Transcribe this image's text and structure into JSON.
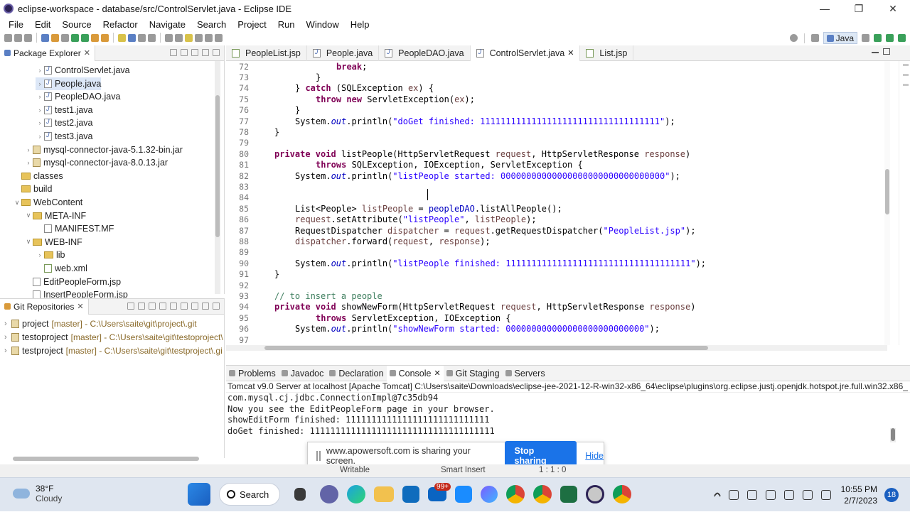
{
  "window": {
    "title": "eclipse-workspace - database/src/ControlServlet.java - Eclipse IDE"
  },
  "menu": [
    "File",
    "Edit",
    "Source",
    "Refactor",
    "Navigate",
    "Search",
    "Project",
    "Run",
    "Window",
    "Help"
  ],
  "perspective": "Java",
  "package_explorer": {
    "title": "Package Explorer",
    "items": [
      {
        "label": "ControlServlet.java",
        "icon": "java",
        "indent": 1,
        "twisty": true
      },
      {
        "label": "People.java",
        "icon": "java",
        "indent": 1,
        "twisty": true,
        "selected": true
      },
      {
        "label": "PeopleDAO.java",
        "icon": "java",
        "indent": 1,
        "twisty": true
      },
      {
        "label": "test1.java",
        "icon": "java",
        "indent": 1,
        "twisty": true
      },
      {
        "label": "test2.java",
        "icon": "java",
        "indent": 1,
        "twisty": true
      },
      {
        "label": "test3.java",
        "icon": "java",
        "indent": 1,
        "twisty": true
      },
      {
        "label": "mysql-connector-java-5.1.32-bin.jar",
        "icon": "jar",
        "indent": 0,
        "twisty": true
      },
      {
        "label": "mysql-connector-java-8.0.13.jar",
        "icon": "jar",
        "indent": 0,
        "twisty": true
      },
      {
        "label": "classes",
        "icon": "folder",
        "indent": -1,
        "twisty": false
      },
      {
        "label": "build",
        "icon": "folder",
        "indent": -1,
        "twisty": false
      },
      {
        "label": "WebContent",
        "icon": "folder",
        "indent": -1,
        "twisty": "open"
      },
      {
        "label": "META-INF",
        "icon": "folder",
        "indent": 0,
        "twisty": "open"
      },
      {
        "label": "MANIFEST.MF",
        "icon": "file",
        "indent": 1,
        "twisty": false
      },
      {
        "label": "WEB-INF",
        "icon": "folder",
        "indent": 0,
        "twisty": "open"
      },
      {
        "label": "lib",
        "icon": "folder",
        "indent": 1,
        "twisty": true
      },
      {
        "label": "web.xml",
        "icon": "xml",
        "indent": 1,
        "twisty": false
      },
      {
        "label": "EditPeopleForm.jsp",
        "icon": "file",
        "indent": 0,
        "twisty": false
      },
      {
        "label": "InsertPeopleForm.jsp",
        "icon": "file",
        "indent": 0,
        "twisty": false
      }
    ]
  },
  "git_repositories": {
    "title": "Git Repositories",
    "items": [
      {
        "name": "project",
        "meta": "[master] - C:\\Users\\saite\\git\\project\\.git"
      },
      {
        "name": "testoproject",
        "meta": "[master] - C:\\Users\\saite\\git\\testoproject\\"
      },
      {
        "name": "testproject",
        "meta": "[master] - C:\\Users\\saite\\git\\testproject\\.gi"
      }
    ]
  },
  "editor": {
    "tabs": [
      {
        "label": "PeopleList.jsp",
        "active": false
      },
      {
        "label": "People.java",
        "active": false
      },
      {
        "label": "PeopleDAO.java",
        "active": false
      },
      {
        "label": "ControlServlet.java",
        "active": true
      },
      {
        "label": "List.jsp",
        "active": false
      }
    ],
    "lines": [
      {
        "n": "72",
        "indent": 12,
        "parts": [
          [
            "kw",
            "break"
          ],
          [
            "t",
            ";"
          ]
        ]
      },
      {
        "n": "73",
        "indent": 8,
        "parts": [
          [
            "t",
            "}"
          ]
        ]
      },
      {
        "n": "74",
        "indent": 4,
        "parts": [
          [
            "t",
            "} "
          ],
          [
            "kw",
            "catch"
          ],
          [
            "t",
            " (SQLException "
          ],
          [
            "var",
            "ex"
          ],
          [
            "t",
            ") {"
          ]
        ]
      },
      {
        "n": "75",
        "indent": 8,
        "parts": [
          [
            "kw",
            "throw new"
          ],
          [
            "t",
            " ServletException("
          ],
          [
            "var",
            "ex"
          ],
          [
            "t",
            ");"
          ]
        ]
      },
      {
        "n": "76",
        "indent": 4,
        "parts": [
          [
            "t",
            "}"
          ]
        ]
      },
      {
        "n": "77",
        "indent": 4,
        "parts": [
          [
            "t",
            "System."
          ],
          [
            "fld",
            "out"
          ],
          [
            "t",
            ".println("
          ],
          [
            "str",
            "\"doGet finished: 11111111111111111111111111111111111\""
          ],
          [
            "t",
            ");"
          ]
        ]
      },
      {
        "n": "78",
        "indent": 0,
        "parts": [
          [
            "t",
            "}"
          ]
        ]
      },
      {
        "n": "79",
        "indent": 0,
        "parts": []
      },
      {
        "n": "80",
        "indent": 0,
        "parts": [
          [
            "kw",
            "private void"
          ],
          [
            "t",
            " listPeople(HttpServletRequest "
          ],
          [
            "var",
            "request"
          ],
          [
            "t",
            ", HttpServletResponse "
          ],
          [
            "var",
            "response"
          ],
          [
            "t",
            ")"
          ]
        ]
      },
      {
        "n": "81",
        "indent": 8,
        "parts": [
          [
            "kw",
            "throws"
          ],
          [
            "t",
            " SQLException, IOException, ServletException {"
          ]
        ]
      },
      {
        "n": "82",
        "indent": 4,
        "parts": [
          [
            "t",
            "System."
          ],
          [
            "fld",
            "out"
          ],
          [
            "t",
            ".println("
          ],
          [
            "str",
            "\"listPeople started: 00000000000000000000000000000000\""
          ],
          [
            "t",
            ");"
          ]
        ]
      },
      {
        "n": "83",
        "indent": 0,
        "parts": []
      },
      {
        "n": "84",
        "indent": 0,
        "parts": []
      },
      {
        "n": "85",
        "indent": 4,
        "parts": [
          [
            "t",
            "List<People> "
          ],
          [
            "var",
            "listPeople"
          ],
          [
            "t",
            " = "
          ],
          [
            "fld2",
            "peopleDAO"
          ],
          [
            "t",
            ".listAllPeople();"
          ]
        ]
      },
      {
        "n": "86",
        "indent": 4,
        "parts": [
          [
            "var",
            "request"
          ],
          [
            "t",
            ".setAttribute("
          ],
          [
            "str",
            "\"listPeople\""
          ],
          [
            "t",
            ", "
          ],
          [
            "var",
            "listPeople"
          ],
          [
            "t",
            ");"
          ]
        ]
      },
      {
        "n": "87",
        "indent": 4,
        "parts": [
          [
            "t",
            "RequestDispatcher "
          ],
          [
            "var",
            "dispatcher"
          ],
          [
            "t",
            " = "
          ],
          [
            "var",
            "request"
          ],
          [
            "t",
            ".getRequestDispatcher("
          ],
          [
            "str",
            "\"PeopleList.jsp\""
          ],
          [
            "t",
            ");"
          ]
        ]
      },
      {
        "n": "88",
        "indent": 4,
        "parts": [
          [
            "var",
            "dispatcher"
          ],
          [
            "t",
            ".forward("
          ],
          [
            "var",
            "request"
          ],
          [
            "t",
            ", "
          ],
          [
            "var",
            "response"
          ],
          [
            "t",
            ");"
          ]
        ]
      },
      {
        "n": "89",
        "indent": 0,
        "parts": []
      },
      {
        "n": "90",
        "indent": 4,
        "parts": [
          [
            "t",
            "System."
          ],
          [
            "fld",
            "out"
          ],
          [
            "t",
            ".println("
          ],
          [
            "str",
            "\"listPeople finished: 111111111111111111111111111111111111\""
          ],
          [
            "t",
            ");"
          ]
        ]
      },
      {
        "n": "91",
        "indent": 0,
        "parts": [
          [
            "t",
            "}"
          ]
        ]
      },
      {
        "n": "92",
        "indent": 0,
        "parts": []
      },
      {
        "n": "93",
        "indent": 0,
        "parts": [
          [
            "cm",
            "// to insert a people"
          ]
        ]
      },
      {
        "n": "94",
        "indent": 0,
        "parts": [
          [
            "kw",
            "private void"
          ],
          [
            "t",
            " showNewForm(HttpServletRequest "
          ],
          [
            "var",
            "request"
          ],
          [
            "t",
            ", HttpServletResponse "
          ],
          [
            "var",
            "response"
          ],
          [
            "t",
            ")"
          ]
        ]
      },
      {
        "n": "95",
        "indent": 8,
        "parts": [
          [
            "kw",
            "throws"
          ],
          [
            "t",
            " ServletException, IOException {"
          ]
        ]
      },
      {
        "n": "96",
        "indent": 4,
        "parts": [
          [
            "t",
            "System."
          ],
          [
            "fld",
            "out"
          ],
          [
            "t",
            ".println("
          ],
          [
            "str",
            "\"showNewForm started: 000000000000000000000000000\""
          ],
          [
            "t",
            ");"
          ]
        ]
      },
      {
        "n": "97",
        "indent": 0,
        "parts": []
      }
    ]
  },
  "console": {
    "tabs": [
      {
        "label": "Problems",
        "active": false
      },
      {
        "label": "Javadoc",
        "active": false
      },
      {
        "label": "Declaration",
        "active": false
      },
      {
        "label": "Console",
        "active": true
      },
      {
        "label": "Git Staging",
        "active": false
      },
      {
        "label": "Servers",
        "active": false
      }
    ],
    "header": "Tomcat v9.0 Server at localhost [Apache Tomcat] C:\\Users\\saite\\Downloads\\eclipse-jee-2021-12-R-win32-x86_64\\eclipse\\plugins\\org.eclipse.justj.openjdk.hotspot.jre.full.win32.x86_",
    "output": [
      "com.mysql.cj.jdbc.ConnectionImpl@7c35db94",
      "Now you see the EditPeopleForm page in your browser.",
      "showEditForm finished: 1111111111111111111111111111",
      "doGet finished: 111111111111111111111111111111111111"
    ]
  },
  "share_bar": {
    "message": "www.apowersoft.com is sharing your screen.",
    "stop_label": "Stop sharing",
    "hide_label": "Hide"
  },
  "status": {
    "writable": "Writable",
    "insert_mode": "Smart Insert",
    "position": "1 : 1 : 0"
  },
  "taskbar": {
    "weather_temp": "38°F",
    "weather_cond": "Cloudy",
    "search_label": "Search",
    "mail_badge": "99+",
    "time": "10:55 PM",
    "date": "2/7/2023",
    "notifications": "18"
  }
}
